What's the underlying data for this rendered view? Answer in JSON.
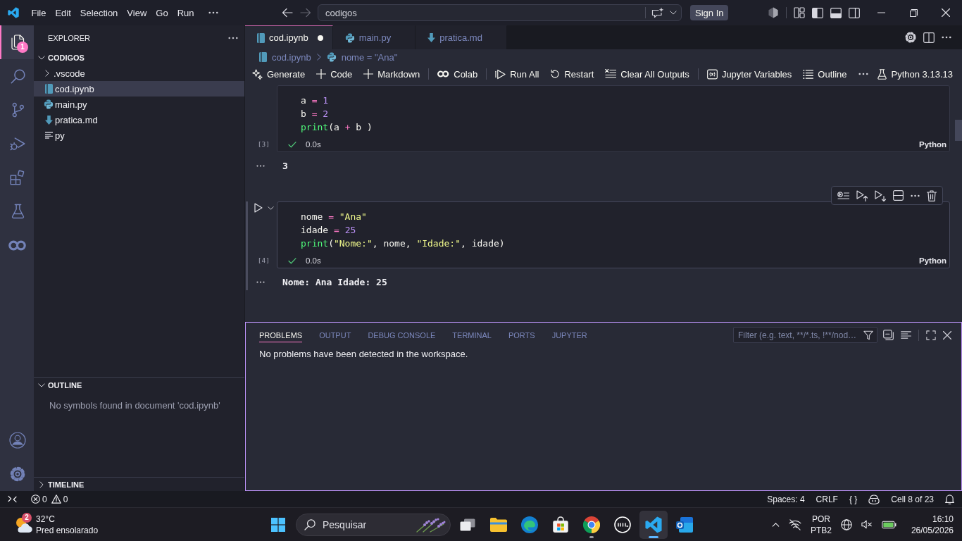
{
  "title_bar": {
    "menu": [
      "File",
      "Edit",
      "Selection",
      "View",
      "Go",
      "Run"
    ],
    "command_center": "codigos",
    "sign_in": "Sign In"
  },
  "activity_bar": {
    "items": [
      {
        "selected": true,
        "badge": "1"
      },
      {
        "selected": false
      },
      {
        "selected": false
      },
      {
        "selected": false
      },
      {
        "selected": false
      },
      {
        "selected": false
      },
      {
        "selected": false
      }
    ]
  },
  "sidebar": {
    "title": "EXPLORER",
    "folder": {
      "name": "CODIGOS",
      "expanded": true,
      "children": [
        {
          "name": ".vscode",
          "kind": "folder",
          "expanded": false,
          "selected": false
        },
        {
          "name": "cod.ipynb",
          "kind": "notebook",
          "selected": true
        },
        {
          "name": "main.py",
          "kind": "python",
          "selected": false
        },
        {
          "name": "pratica.md",
          "kind": "markdown",
          "selected": false
        },
        {
          "name": "py",
          "kind": "text",
          "selected": false
        }
      ]
    },
    "outline": {
      "title": "OUTLINE",
      "expanded": true,
      "message": "No symbols found in document 'cod.ipynb'"
    },
    "timeline": {
      "title": "TIMELINE",
      "expanded": false
    }
  },
  "editor": {
    "tabs": [
      {
        "label": "cod.ipynb",
        "kind": "notebook",
        "selected": true,
        "modified": true
      },
      {
        "label": "main.py",
        "kind": "python",
        "selected": false,
        "modified": false
      },
      {
        "label": "pratica.md",
        "kind": "markdown",
        "selected": false,
        "modified": false
      }
    ],
    "breadcrumb": [
      {
        "label": "cod.ipynb",
        "kind": "notebook"
      },
      {
        "label": "nome = \"Ana\"",
        "kind": "python"
      }
    ],
    "notebook_toolbar": {
      "groups": [
        [
          "Generate",
          "Code",
          "Markdown"
        ],
        [
          "Colab"
        ],
        [
          "Run All",
          "Restart",
          "Clear All Outputs"
        ],
        [
          "Jupyter Variables",
          "Outline"
        ]
      ],
      "kernel": "Python 3.13.13"
    },
    "cells": [
      {
        "execution_count": "[3]",
        "selected": false,
        "lines": [
          [
            {
              "kind": "text",
              "text": "a "
            },
            {
              "kind": "op",
              "text": "= "
            },
            {
              "kind": "num",
              "text": "1"
            }
          ],
          [
            {
              "kind": "text",
              "text": "b "
            },
            {
              "kind": "op",
              "text": "= "
            },
            {
              "kind": "num",
              "text": "2"
            }
          ],
          [
            {
              "kind": "fn",
              "text": "print"
            },
            {
              "kind": "text",
              "text": "(a "
            },
            {
              "kind": "op",
              "text": "+ "
            },
            {
              "kind": "text",
              "text": "b )"
            }
          ]
        ],
        "succeeded": true,
        "duration": "0.0s",
        "language": "Python",
        "output": "3"
      },
      {
        "execution_count": "[4]",
        "selected": true,
        "lines": [
          [
            {
              "kind": "text",
              "text": "nome "
            },
            {
              "kind": "op",
              "text": "= "
            },
            {
              "kind": "str",
              "text": "\"Ana\""
            }
          ],
          [
            {
              "kind": "text",
              "text": "idade "
            },
            {
              "kind": "op",
              "text": "= "
            },
            {
              "kind": "num",
              "text": "25"
            }
          ],
          [
            {
              "kind": "fn",
              "text": "print"
            },
            {
              "kind": "text",
              "text": "("
            },
            {
              "kind": "str",
              "text": "\"Nome:\""
            },
            {
              "kind": "text",
              "text": ", nome, "
            },
            {
              "kind": "str",
              "text": "\"Idade:\""
            },
            {
              "kind": "text",
              "text": ", idade)"
            }
          ]
        ],
        "succeeded": true,
        "duration": "0.0s",
        "language": "Python",
        "output": "Nome: Ana Idade: 25"
      }
    ]
  },
  "panel": {
    "tabs": [
      {
        "label": "PROBLEMS",
        "selected": true
      },
      {
        "label": "OUTPUT",
        "selected": false
      },
      {
        "label": "DEBUG CONSOLE",
        "selected": false
      },
      {
        "label": "TERMINAL",
        "selected": false
      },
      {
        "label": "PORTS",
        "selected": false
      },
      {
        "label": "JUPYTER",
        "selected": false
      }
    ],
    "filter": {
      "placeholder": "Filter (e.g. text, **/*.ts, !**/nod…"
    },
    "message": "No problems have been detected in the workspace."
  },
  "status_bar": {
    "errors": "0",
    "warnings": "0",
    "indentation": "Spaces: 4",
    "line_ending": "CRLF",
    "language_status": "{ }",
    "cell_position": "Cell 8 of 23"
  },
  "taskbar": {
    "weather": {
      "temperature": "32°C",
      "condition": "Pred ensolarado",
      "badge": "2"
    },
    "search": {
      "placeholder": "Pesquisar"
    },
    "apps": [
      {
        "selected": false,
        "running": false
      },
      {
        "selected": false,
        "running": false
      },
      {
        "selected": false,
        "running": false
      },
      {
        "selected": false,
        "running": false
      },
      {
        "selected": false,
        "running": true
      },
      {
        "selected": false,
        "running": false
      },
      {
        "selected": true,
        "running": true
      },
      {
        "selected": false,
        "running": false
      }
    ],
    "tray": {
      "language": "POR",
      "layout": "PTB2",
      "time": "16:10",
      "date": "26/05/2026"
    }
  }
}
